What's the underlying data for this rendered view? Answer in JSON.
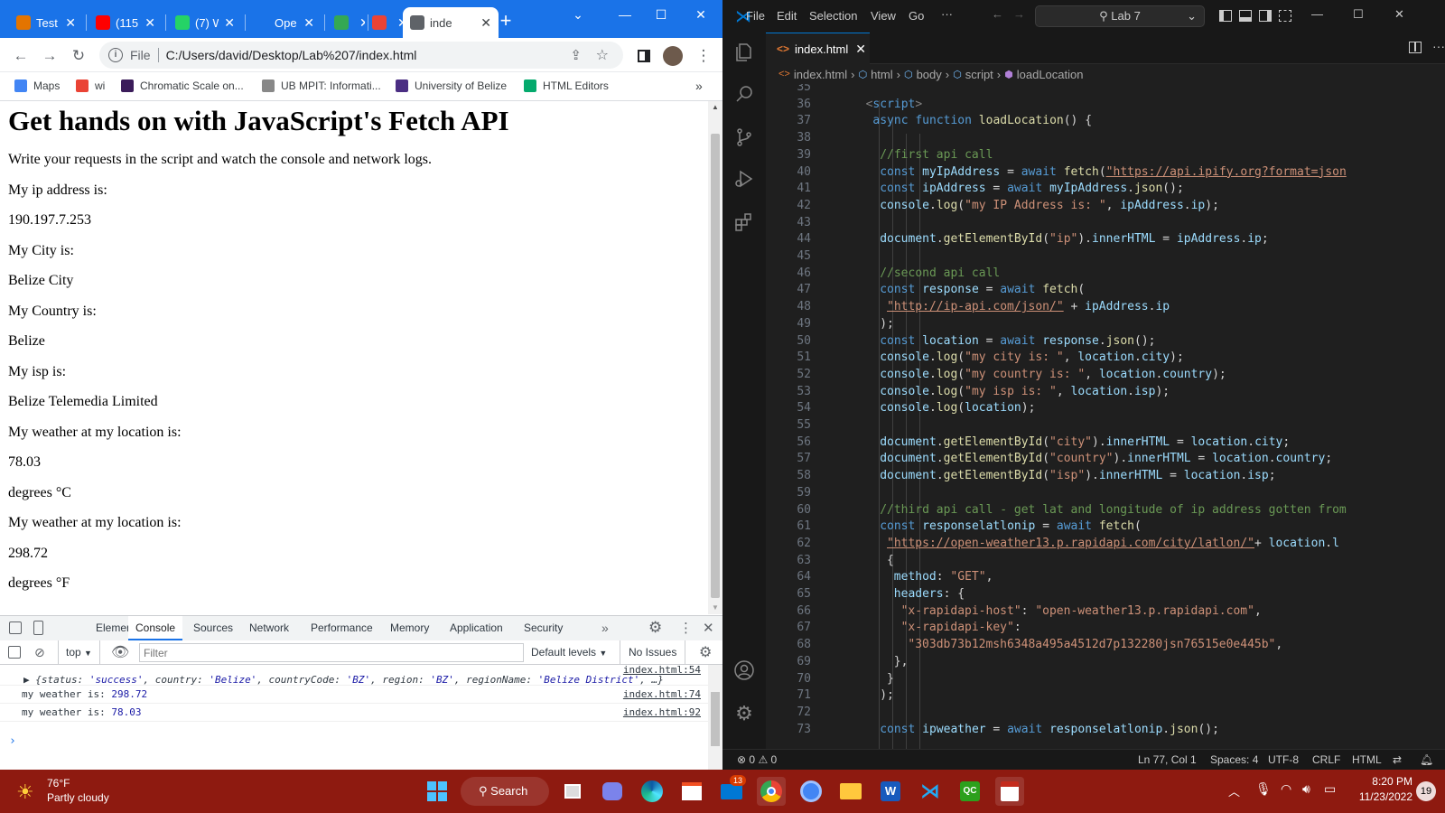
{
  "browser": {
    "tabs": [
      {
        "title": "Test",
        "fav_color": "#e37400"
      },
      {
        "title": "(115",
        "fav_color": "#ff0000"
      },
      {
        "title": "(7) W",
        "fav_color": "#25d366"
      },
      {
        "title": "Ope",
        "fav_color": "#1a73e8"
      },
      {
        "title": "",
        "fav_color": "#34a853"
      },
      {
        "title": "",
        "fav_color": "#ea4335"
      },
      {
        "title": "inde",
        "fav_color": "#5f6368"
      }
    ],
    "new_tab": "+",
    "address_prefix": "File",
    "url": "C:/Users/david/Desktop/Lab%207/index.html",
    "bookmarks": [
      {
        "label": "Maps",
        "color": "#4285f4"
      },
      {
        "label": "wi",
        "color": "#ea4335"
      },
      {
        "label": "Chromatic Scale on...",
        "color": "#3b1c5a"
      },
      {
        "label": "UB MPIT: Informati...",
        "color": "#888888"
      },
      {
        "label": "University of Belize",
        "color": "#4b2e83"
      },
      {
        "label": "HTML Editors",
        "color": "#04aa6d"
      }
    ],
    "bookmarks_more": "»"
  },
  "page": {
    "heading": "Get hands on with JavaScript's Fetch API",
    "lines": [
      "Write your requests in the script and watch the console and network logs.",
      "My ip address is:",
      "190.197.7.253",
      "My City is:",
      "Belize City",
      "My Country is:",
      "Belize",
      "My isp is:",
      "Belize Telemedia Limited",
      "My weather at my location is:",
      "78.03",
      "degrees °C",
      "My weather at my location is:",
      "298.72",
      "degrees °F"
    ]
  },
  "devtools": {
    "tabs": [
      "Elements",
      "Console",
      "Sources",
      "Network",
      "Performance",
      "Memory",
      "Application",
      "Security"
    ],
    "more": "»",
    "context": "top",
    "filter_placeholder": "Filter",
    "levels": "Default levels",
    "issues": "No Issues",
    "logs": [
      {
        "source": "index.html:54",
        "parts": [
          {
            "t": "▶ {status: ",
            "c": "#303942"
          },
          {
            "t": "'success'",
            "c": "#1a1aa6"
          },
          {
            "t": ", country: ",
            "c": "#303942"
          },
          {
            "t": "'Belize'",
            "c": "#1a1aa6"
          },
          {
            "t": ", countryCode: ",
            "c": "#303942"
          },
          {
            "t": "'BZ'",
            "c": "#1a1aa6"
          },
          {
            "t": ", region: ",
            "c": "#303942"
          },
          {
            "t": "'BZ'",
            "c": "#1a1aa6"
          },
          {
            "t": ", regionName: ",
            "c": "#303942"
          },
          {
            "t": "'Belize District'",
            "c": "#1a1aa6"
          },
          {
            "t": ", …}",
            "c": "#303942"
          }
        ]
      },
      {
        "source": "index.html:74",
        "parts": [
          {
            "t": "my weather is:  ",
            "c": "#303942"
          },
          {
            "t": "298.72",
            "c": "#1a1aa6"
          }
        ]
      },
      {
        "source": "index.html:92",
        "parts": [
          {
            "t": "my weather is:  ",
            "c": "#303942"
          },
          {
            "t": "78.03",
            "c": "#1a1aa6"
          }
        ]
      }
    ],
    "prompt": "›"
  },
  "vscode": {
    "menu": [
      "File",
      "Edit",
      "Selection",
      "View",
      "Go"
    ],
    "menu_more": "···",
    "search": "Lab 7",
    "tab": "index.html",
    "breadcrumb": [
      "index.html",
      "html",
      "body",
      "script",
      "loadLocation"
    ],
    "status": {
      "problems": "0",
      "warnings": "0",
      "position": "Ln 77, Col 1",
      "spaces": "Spaces: 4",
      "encoding": "UTF-8",
      "eol": "CRLF",
      "lang": "HTML"
    },
    "code": [
      {
        "n": 35,
        "i": 0,
        "p": []
      },
      {
        "n": 36,
        "i": 2,
        "p": [
          [
            "t",
            "<"
          ],
          [
            "k",
            "script"
          ],
          [
            "t",
            ">"
          ]
        ]
      },
      {
        "n": 37,
        "i": 3,
        "p": [
          [
            "k",
            "async function "
          ],
          [
            "f",
            "loadLocation"
          ],
          [
            "",
            "() {"
          ]
        ]
      },
      {
        "n": 38,
        "i": 0,
        "p": []
      },
      {
        "n": 39,
        "i": 4,
        "p": [
          [
            "c",
            "//first api call"
          ]
        ]
      },
      {
        "n": 40,
        "i": 4,
        "p": [
          [
            "k",
            "const "
          ],
          [
            "v",
            "myIpAddress"
          ],
          [
            "",
            " = "
          ],
          [
            "k",
            "await "
          ],
          [
            "f",
            "fetch"
          ],
          [
            "",
            "("
          ],
          [
            "su",
            "\"https://api.ipify.org?format=json"
          ]
        ]
      },
      {
        "n": 41,
        "i": 4,
        "p": [
          [
            "k",
            "const "
          ],
          [
            "v",
            "ipAddress"
          ],
          [
            "",
            " = "
          ],
          [
            "k",
            "await "
          ],
          [
            "v",
            "myIpAddress"
          ],
          [
            "",
            "."
          ],
          [
            "f",
            "json"
          ],
          [
            "",
            "();"
          ]
        ]
      },
      {
        "n": 42,
        "i": 4,
        "p": [
          [
            "v",
            "console"
          ],
          [
            "",
            "."
          ],
          [
            "f",
            "log"
          ],
          [
            "",
            "("
          ],
          [
            "s",
            "\"my IP Address is: \""
          ],
          [
            "",
            ", "
          ],
          [
            "v",
            "ipAddress"
          ],
          [
            "",
            "."
          ],
          [
            "v",
            "ip"
          ],
          [
            "",
            ");"
          ]
        ]
      },
      {
        "n": 43,
        "i": 0,
        "p": []
      },
      {
        "n": 44,
        "i": 4,
        "p": [
          [
            "v",
            "document"
          ],
          [
            "",
            "."
          ],
          [
            "f",
            "getElementById"
          ],
          [
            "",
            "("
          ],
          [
            "s",
            "\"ip\""
          ],
          [
            "",
            ")."
          ],
          [
            "v",
            "innerHTML"
          ],
          [
            "",
            " = "
          ],
          [
            "v",
            "ipAddress"
          ],
          [
            "",
            "."
          ],
          [
            "v",
            "ip"
          ],
          [
            "",
            ";"
          ]
        ]
      },
      {
        "n": 45,
        "i": 0,
        "p": []
      },
      {
        "n": 46,
        "i": 4,
        "p": [
          [
            "c",
            "//second api call"
          ]
        ]
      },
      {
        "n": 47,
        "i": 4,
        "p": [
          [
            "k",
            "const "
          ],
          [
            "v",
            "response"
          ],
          [
            "",
            " = "
          ],
          [
            "k",
            "await "
          ],
          [
            "f",
            "fetch"
          ],
          [
            "",
            "("
          ]
        ]
      },
      {
        "n": 48,
        "i": 5,
        "p": [
          [
            "su",
            "\"http://ip-api.com/json/\""
          ],
          [
            "",
            " + "
          ],
          [
            "v",
            "ipAddress"
          ],
          [
            "",
            "."
          ],
          [
            "v",
            "ip"
          ]
        ]
      },
      {
        "n": 49,
        "i": 4,
        "p": [
          [
            "",
            ");"
          ]
        ]
      },
      {
        "n": 50,
        "i": 4,
        "p": [
          [
            "k",
            "const "
          ],
          [
            "v",
            "location"
          ],
          [
            "",
            " = "
          ],
          [
            "k",
            "await "
          ],
          [
            "v",
            "response"
          ],
          [
            "",
            "."
          ],
          [
            "f",
            "json"
          ],
          [
            "",
            "();"
          ]
        ]
      },
      {
        "n": 51,
        "i": 4,
        "p": [
          [
            "v",
            "console"
          ],
          [
            "",
            "."
          ],
          [
            "f",
            "log"
          ],
          [
            "",
            "("
          ],
          [
            "s",
            "\"my city is: \""
          ],
          [
            "",
            ", "
          ],
          [
            "v",
            "location"
          ],
          [
            "",
            "."
          ],
          [
            "v",
            "city"
          ],
          [
            "",
            ");"
          ]
        ]
      },
      {
        "n": 52,
        "i": 4,
        "p": [
          [
            "v",
            "console"
          ],
          [
            "",
            "."
          ],
          [
            "f",
            "log"
          ],
          [
            "",
            "("
          ],
          [
            "s",
            "\"my country is: \""
          ],
          [
            "",
            ", "
          ],
          [
            "v",
            "location"
          ],
          [
            "",
            "."
          ],
          [
            "v",
            "country"
          ],
          [
            "",
            ");"
          ]
        ]
      },
      {
        "n": 53,
        "i": 4,
        "p": [
          [
            "v",
            "console"
          ],
          [
            "",
            "."
          ],
          [
            "f",
            "log"
          ],
          [
            "",
            "("
          ],
          [
            "s",
            "\"my isp is: \""
          ],
          [
            "",
            ", "
          ],
          [
            "v",
            "location"
          ],
          [
            "",
            "."
          ],
          [
            "v",
            "isp"
          ],
          [
            "",
            ");"
          ]
        ]
      },
      {
        "n": 54,
        "i": 4,
        "p": [
          [
            "v",
            "console"
          ],
          [
            "",
            "."
          ],
          [
            "f",
            "log"
          ],
          [
            "",
            "("
          ],
          [
            "v",
            "location"
          ],
          [
            "",
            ");"
          ]
        ]
      },
      {
        "n": 55,
        "i": 0,
        "p": []
      },
      {
        "n": 56,
        "i": 4,
        "p": [
          [
            "v",
            "document"
          ],
          [
            "",
            "."
          ],
          [
            "f",
            "getElementById"
          ],
          [
            "",
            "("
          ],
          [
            "s",
            "\"city\""
          ],
          [
            "",
            ")."
          ],
          [
            "v",
            "innerHTML"
          ],
          [
            "",
            " = "
          ],
          [
            "v",
            "location"
          ],
          [
            "",
            "."
          ],
          [
            "v",
            "city"
          ],
          [
            "",
            ";"
          ]
        ]
      },
      {
        "n": 57,
        "i": 4,
        "p": [
          [
            "v",
            "document"
          ],
          [
            "",
            "."
          ],
          [
            "f",
            "getElementById"
          ],
          [
            "",
            "("
          ],
          [
            "s",
            "\"country\""
          ],
          [
            "",
            ")."
          ],
          [
            "v",
            "innerHTML"
          ],
          [
            "",
            " = "
          ],
          [
            "v",
            "location"
          ],
          [
            "",
            "."
          ],
          [
            "v",
            "country"
          ],
          [
            "",
            ";"
          ]
        ]
      },
      {
        "n": 58,
        "i": 4,
        "p": [
          [
            "v",
            "document"
          ],
          [
            "",
            "."
          ],
          [
            "f",
            "getElementById"
          ],
          [
            "",
            "("
          ],
          [
            "s",
            "\"isp\""
          ],
          [
            "",
            ")."
          ],
          [
            "v",
            "innerHTML"
          ],
          [
            "",
            " = "
          ],
          [
            "v",
            "location"
          ],
          [
            "",
            "."
          ],
          [
            "v",
            "isp"
          ],
          [
            "",
            ";"
          ]
        ]
      },
      {
        "n": 59,
        "i": 0,
        "p": []
      },
      {
        "n": 60,
        "i": 4,
        "p": [
          [
            "c",
            "//third api call - get lat and longitude of ip address gotten from"
          ]
        ]
      },
      {
        "n": 61,
        "i": 4,
        "p": [
          [
            "k",
            "const "
          ],
          [
            "v",
            "responselatlonip"
          ],
          [
            "",
            " = "
          ],
          [
            "k",
            "await "
          ],
          [
            "f",
            "fetch"
          ],
          [
            "",
            "("
          ]
        ]
      },
      {
        "n": 62,
        "i": 5,
        "p": [
          [
            "su",
            "\"https://open-weather13.p.rapidapi.com/city/latlon/\""
          ],
          [
            "",
            "+ "
          ],
          [
            "v",
            "location"
          ],
          [
            "",
            "."
          ],
          [
            "v",
            "l"
          ]
        ]
      },
      {
        "n": 63,
        "i": 5,
        "p": [
          [
            "",
            "{"
          ]
        ]
      },
      {
        "n": 64,
        "i": 6,
        "p": [
          [
            "v",
            "method"
          ],
          [
            "",
            ": "
          ],
          [
            "s",
            "\"GET\""
          ],
          [
            "",
            ","
          ]
        ]
      },
      {
        "n": 65,
        "i": 6,
        "p": [
          [
            "v",
            "headers"
          ],
          [
            "",
            ": {"
          ]
        ]
      },
      {
        "n": 66,
        "i": 7,
        "p": [
          [
            "s",
            "\"x-rapidapi-host\""
          ],
          [
            "",
            ": "
          ],
          [
            "s",
            "\"open-weather13.p.rapidapi.com\""
          ],
          [
            "",
            ","
          ]
        ]
      },
      {
        "n": 67,
        "i": 7,
        "p": [
          [
            "s",
            "\"x-rapidapi-key\""
          ],
          [
            "",
            ":"
          ]
        ]
      },
      {
        "n": 68,
        "i": 8,
        "p": [
          [
            "s",
            "\"303db73b12msh6348a495a4512d7p132280jsn76515e0e445b\""
          ],
          [
            "",
            ","
          ]
        ]
      },
      {
        "n": 69,
        "i": 6,
        "p": [
          [
            "",
            "},"
          ]
        ]
      },
      {
        "n": 70,
        "i": 5,
        "p": [
          [
            "",
            "}"
          ]
        ]
      },
      {
        "n": 71,
        "i": 4,
        "p": [
          [
            "",
            ");"
          ]
        ]
      },
      {
        "n": 72,
        "i": 0,
        "p": []
      },
      {
        "n": 73,
        "i": 4,
        "p": [
          [
            "k",
            "const "
          ],
          [
            "v",
            "ipweather"
          ],
          [
            "",
            " = "
          ],
          [
            "k",
            "await "
          ],
          [
            "v",
            "responselatlonip"
          ],
          [
            "",
            "."
          ],
          [
            "f",
            "json"
          ],
          [
            "",
            "();"
          ]
        ]
      }
    ]
  },
  "taskbar": {
    "weather_temp": "76°F",
    "weather_desc": "Partly cloudy",
    "search": "Search",
    "mail_badge": "13",
    "time": "8:20 PM",
    "date": "11/23/2022",
    "notif": "19"
  }
}
